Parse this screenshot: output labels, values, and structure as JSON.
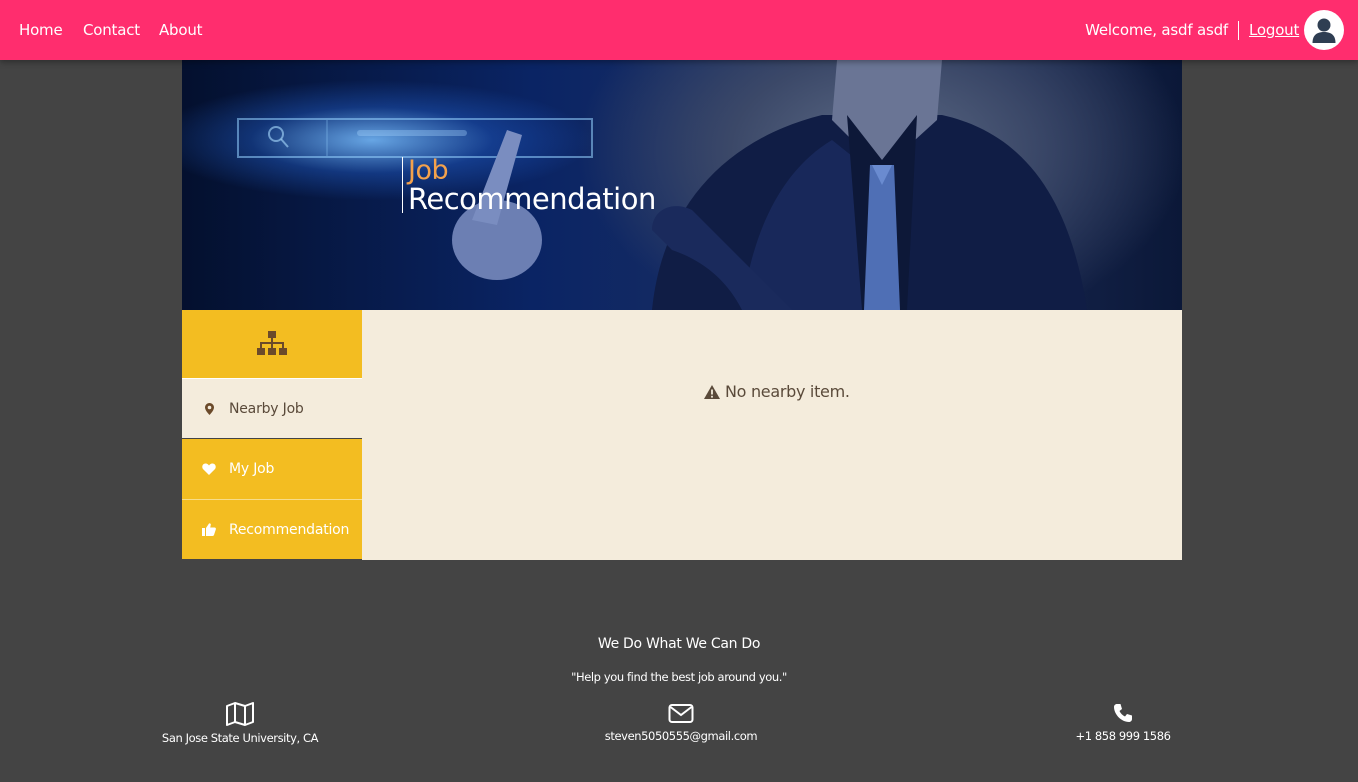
{
  "nav": {
    "links": [
      "Home",
      "Contact",
      "About"
    ],
    "welcome": "Welcome, asdf asdf",
    "logout": "Logout",
    "avatar_icon": "user-avatar-icon",
    "bar_color": "#ff2d6e"
  },
  "hero": {
    "title_line1": "Job",
    "title_line2": "Recommendation",
    "accent_color": "#f4a24c"
  },
  "sidebar": {
    "header_icon": "sitemap-icon",
    "items": [
      {
        "label": "Nearby Job",
        "icon": "map-marker-icon",
        "active": true
      },
      {
        "label": "My Job",
        "icon": "heart-icon",
        "active": false
      },
      {
        "label": "Recommendation",
        "icon": "thumbs-up-icon",
        "active": false
      }
    ],
    "accent_color": "#f3bd21"
  },
  "main": {
    "empty_icon": "warning-icon",
    "empty_message": "No nearby item."
  },
  "footer": {
    "title": "We Do What We Can Do",
    "quote": "\"Help you find the best job around you.\"",
    "address": "San Jose State University, CA",
    "email": "steven5050555@gmail.com",
    "phone": "+1 858 999 1586"
  }
}
